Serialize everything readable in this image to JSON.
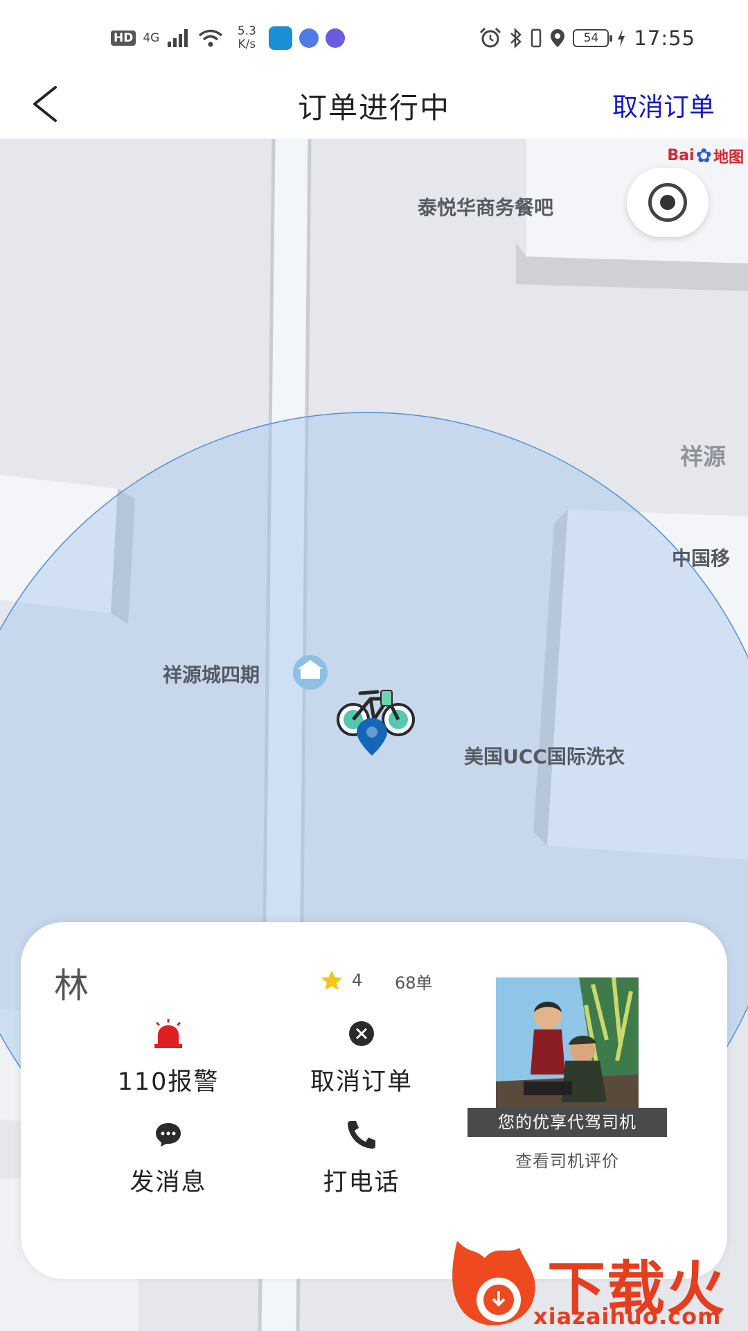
{
  "status_bar": {
    "hd_badge": "HD",
    "network": "4G",
    "speed_value": "5.3",
    "speed_unit": "K/s",
    "battery": "54",
    "time": "17:55"
  },
  "header": {
    "title": "订单进行中",
    "cancel_order": "取消订单"
  },
  "map": {
    "labels": {
      "restaurant": "泰悦华商务餐吧",
      "xiangyuan_partial": "祥源",
      "china_mobile_partial": "中国移",
      "xiangyuan_phase4": "祥源城四期",
      "laundry": "美国UCC国际洗衣"
    },
    "logo": {
      "bai": "Bai",
      "du": "du",
      "map": "地图"
    }
  },
  "driver_card": {
    "name": "林",
    "rating": "4",
    "order_count": "68单",
    "actions": {
      "police": "110报警",
      "cancel": "取消订单",
      "message": "发消息",
      "call": "打电话"
    },
    "photo_badge": "您的优享代驾司机",
    "view_reviews": "查看司机评价"
  },
  "watermark": {
    "brand": "下载火",
    "domain": "xiazaihuo.com"
  },
  "colors": {
    "accent_blue": "#1219c9",
    "alarm_red": "#e02020",
    "star_yellow": "#f5c518",
    "watermark_orange": "#e53e1f"
  },
  "icons": {
    "back": "chevron-left-icon",
    "locate": "locate-icon",
    "police": "siren-icon",
    "cancel": "close-circle-icon",
    "message": "chat-bubble-icon",
    "call": "phone-icon"
  }
}
